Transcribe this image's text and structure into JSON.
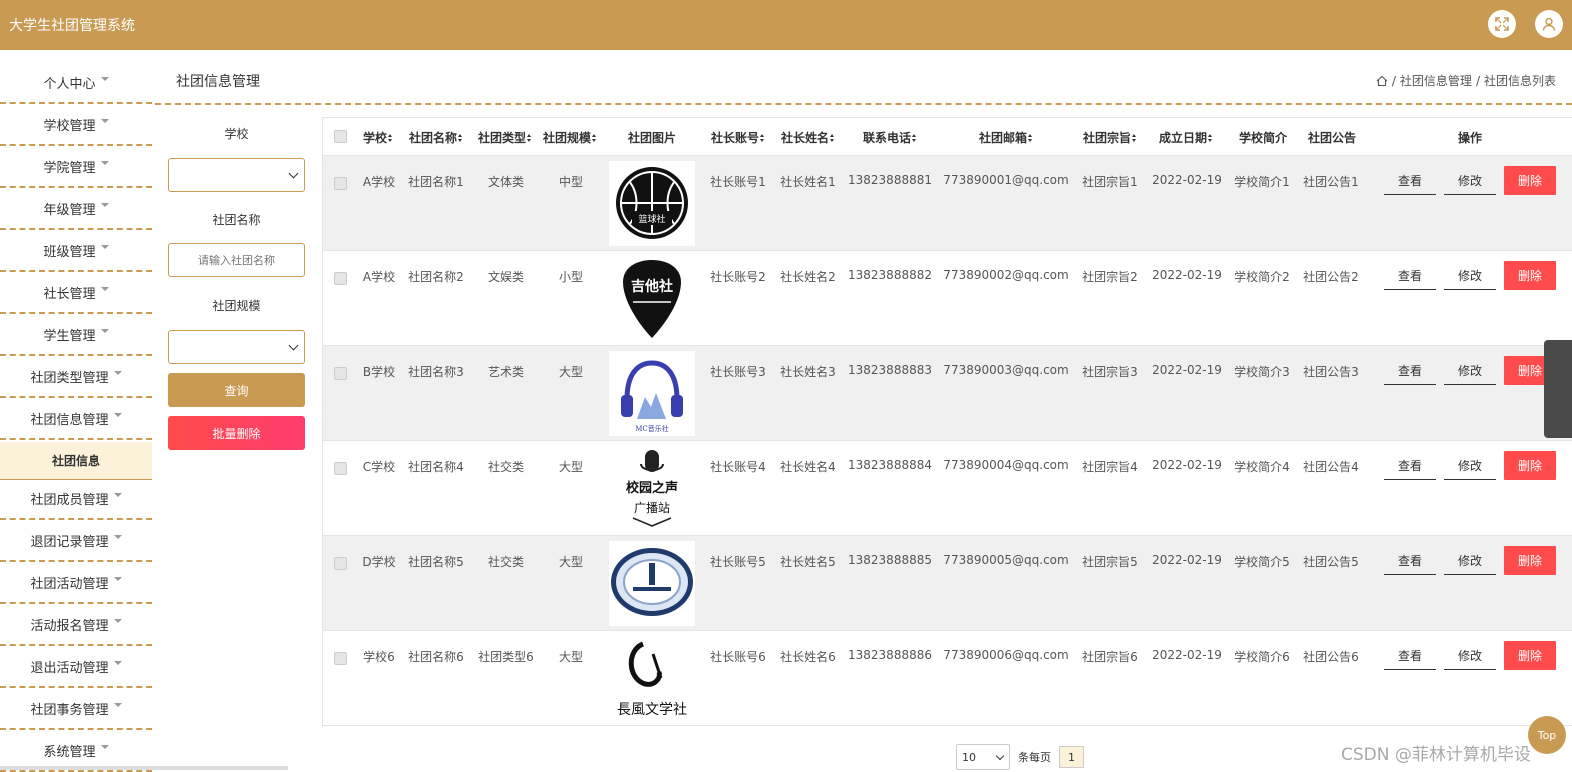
{
  "header": {
    "title": "大学生社团管理系统",
    "fullscreen_icon": "fullscreen-icon",
    "user_icon": "user-icon"
  },
  "colors": {
    "accent": "#c99a52",
    "danger": "#ff4b4b",
    "highlight": "#fbf2d9"
  },
  "sidebar": {
    "items": [
      {
        "label": "个人中心"
      },
      {
        "label": "学校管理"
      },
      {
        "label": "学院管理"
      },
      {
        "label": "年级管理"
      },
      {
        "label": "班级管理"
      },
      {
        "label": "社长管理"
      },
      {
        "label": "学生管理"
      },
      {
        "label": "社团类型管理"
      },
      {
        "label": "社团信息管理"
      },
      {
        "label": "社团成员管理"
      },
      {
        "label": "退团记录管理"
      },
      {
        "label": "社团活动管理"
      },
      {
        "label": "活动报名管理"
      },
      {
        "label": "退出活动管理"
      },
      {
        "label": "社团事务管理"
      },
      {
        "label": "系统管理"
      }
    ],
    "active_sub": "社团信息"
  },
  "page": {
    "title": "社团信息管理",
    "breadcrumb": {
      "home_icon": "home-icon",
      "sep1": "/",
      "level1": "社团信息管理",
      "sep2": "/",
      "level2": "社团信息列表"
    }
  },
  "filters": {
    "school_label": "学校",
    "name_label": "社团名称",
    "name_placeholder": "请输入社团名称",
    "scale_label": "社团规模",
    "query_button": "查询",
    "batch_delete_button": "批量删除"
  },
  "table": {
    "columns": [
      "学校",
      "社团名称",
      "社团类型",
      "社团规模",
      "社团图片",
      "社长账号",
      "社长姓名",
      "联系电话",
      "社团邮箱",
      "社团宗旨",
      "成立日期",
      "学校简介",
      "社团公告",
      "操作"
    ],
    "rows": [
      {
        "school": "A学校",
        "name": "社团名称1",
        "type": "文体类",
        "scale": "中型",
        "logo_text": "篮球社",
        "account": "社长账号1",
        "leader": "社长姓名1",
        "phone": "13823888881",
        "email": "773890001@qq.com",
        "purpose": "社团宗旨1",
        "date": "2022-02-19",
        "intro": "学校简介1",
        "notice": "社团公告1"
      },
      {
        "school": "A学校",
        "name": "社团名称2",
        "type": "文娱类",
        "scale": "小型",
        "logo_text": "吉他社",
        "account": "社长账号2",
        "leader": "社长姓名2",
        "phone": "13823888882",
        "email": "773890002@qq.com",
        "purpose": "社团宗旨2",
        "date": "2022-02-19",
        "intro": "学校简介2",
        "notice": "社团公告2"
      },
      {
        "school": "B学校",
        "name": "社团名称3",
        "type": "艺术类",
        "scale": "大型",
        "logo_text": "MC音乐社",
        "account": "社长账号3",
        "leader": "社长姓名3",
        "phone": "13823888883",
        "email": "773890003@qq.com",
        "purpose": "社团宗旨3",
        "date": "2022-02-19",
        "intro": "学校简介3",
        "notice": "社团公告3"
      },
      {
        "school": "C学校",
        "name": "社团名称4",
        "type": "社交类",
        "scale": "大型",
        "logo_text": "校园之声",
        "logo_text2": "广播站",
        "account": "社长账号4",
        "leader": "社长姓名4",
        "phone": "13823888884",
        "email": "773890004@qq.com",
        "purpose": "社团宗旨4",
        "date": "2022-02-19",
        "intro": "学校简介4",
        "notice": "社团公告4"
      },
      {
        "school": "D学校",
        "name": "社团名称5",
        "type": "社交类",
        "scale": "大型",
        "logo_text": "",
        "account": "社长账号5",
        "leader": "社长姓名5",
        "phone": "13823888885",
        "email": "773890005@qq.com",
        "purpose": "社团宗旨5",
        "date": "2022-02-19",
        "intro": "学校简介5",
        "notice": "社团公告5"
      },
      {
        "school": "学校6",
        "name": "社团名称6",
        "type": "社团类型6",
        "scale": "大型",
        "logo_text": "長風文学社",
        "account": "社长账号6",
        "leader": "社长姓名6",
        "phone": "13823888886",
        "email": "773890006@qq.com",
        "purpose": "社团宗旨6",
        "date": "2022-02-19",
        "intro": "学校简介6",
        "notice": "社团公告6"
      }
    ],
    "actions": {
      "view": "查看",
      "edit": "修改",
      "delete": "删除"
    }
  },
  "pagination": {
    "page_size": "10",
    "per_page_label": "条每页",
    "current_page": "1"
  },
  "top_button": "Top",
  "watermark": "CSDN @菲林计算机毕设"
}
